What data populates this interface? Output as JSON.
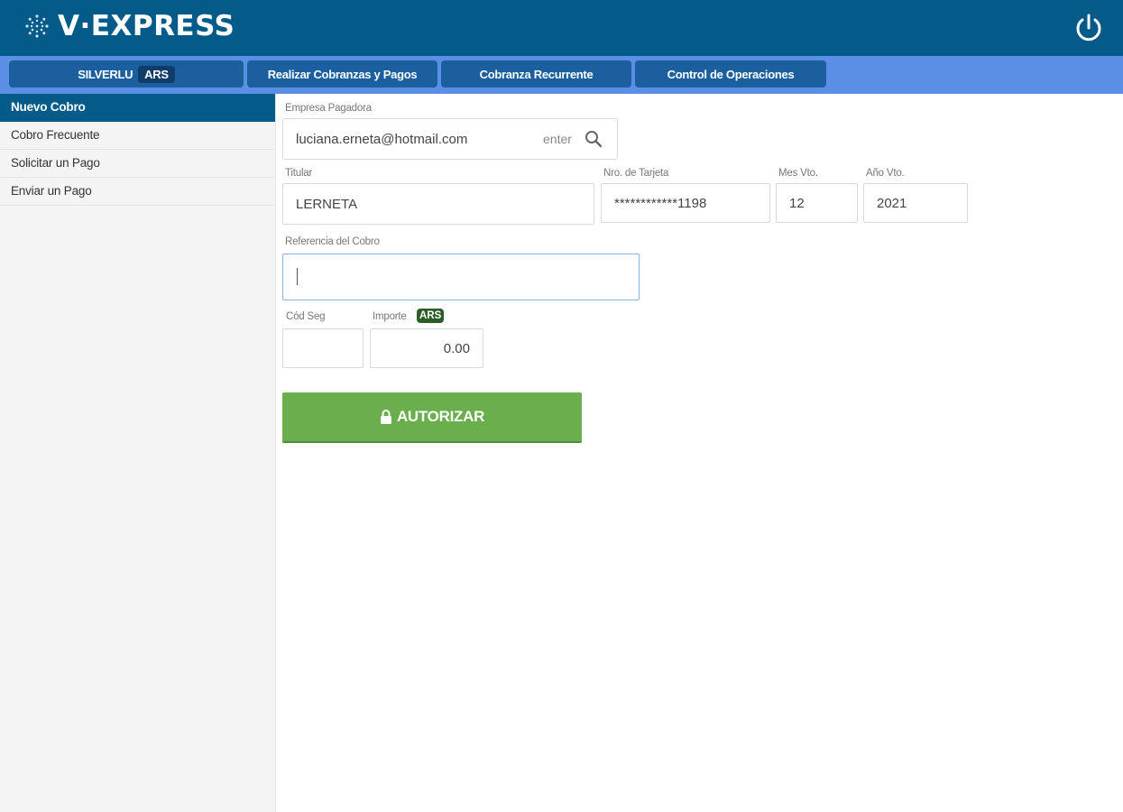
{
  "header": {
    "brand": "V·EXPRESS",
    "logo_icon": "globe-dots-icon",
    "power_icon": "power-icon",
    "bg_color": "#045a89"
  },
  "nav": {
    "tabs": [
      {
        "label": "SILVERLU",
        "badge": "ARS"
      },
      {
        "label": "Realizar Cobranzas y Pagos"
      },
      {
        "label": "Cobranza Recurrente"
      },
      {
        "label": "Control de Operaciones"
      }
    ],
    "bar_color": "#5b8fe6",
    "tab_color": "#1b5f9e"
  },
  "sidebar": {
    "items": [
      {
        "label": "Nuevo Cobro",
        "active": true
      },
      {
        "label": "Cobro Frecuente"
      },
      {
        "label": "Solicitar un Pago"
      },
      {
        "label": "Enviar un Pago"
      }
    ]
  },
  "form": {
    "empresa": {
      "label": "Empresa Pagadora",
      "value": "luciana.erneta@hotmail.com",
      "hint": "enter"
    },
    "titular": {
      "label": "Titular",
      "value": "LERNETA"
    },
    "tarjeta": {
      "label": "Nro. de Tarjeta",
      "value": "************1198"
    },
    "mes": {
      "label": "Mes Vto.",
      "value": "12"
    },
    "anio": {
      "label": "Año Vto.",
      "value": "2021"
    },
    "referencia": {
      "label": "Referencia del Cobro",
      "value": ""
    },
    "cod_seg": {
      "label": "Cód Seg",
      "value": ""
    },
    "importe": {
      "label": "Importe",
      "currency": "ARS",
      "value": "0.00"
    },
    "submit": {
      "label": "AUTORIZAR",
      "icon": "lock-icon",
      "color": "#6aae4e"
    }
  }
}
